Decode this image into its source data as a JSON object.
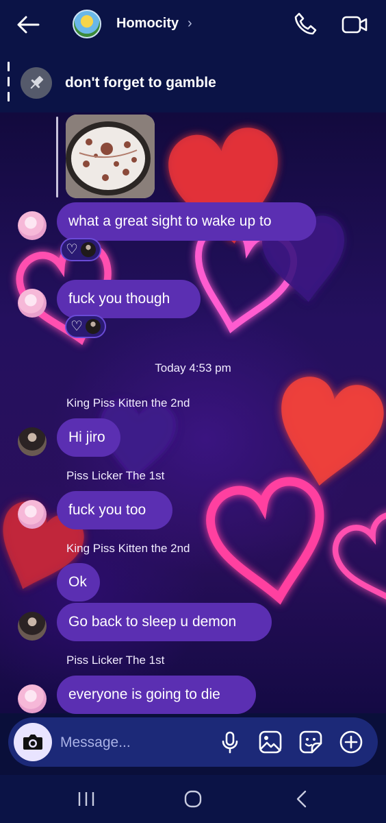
{
  "header": {
    "title": "Homocity",
    "chevron": "›",
    "icons": {
      "back": "back-arrow-icon",
      "call": "phone-icon",
      "video": "video-camera-icon"
    }
  },
  "pinned": {
    "text": "don't forget to gamble",
    "icon": "pin-icon"
  },
  "messages": [
    {
      "text": "what a great sight to wake up to",
      "reactions": [
        "♡"
      ]
    },
    {
      "text": "fuck you though",
      "reactions": [
        "♡"
      ]
    },
    {
      "sender": "King Piss Kitten the 2nd",
      "text": "Hi jiro"
    },
    {
      "sender": "Piss Licker The 1st",
      "text": "fuck you too"
    },
    {
      "sender": "King Piss Kitten the 2nd",
      "text": "Ok"
    },
    {
      "text": "Go back to sleep u demon"
    },
    {
      "sender": "Piss Licker The 1st",
      "text": "everyone is going to die"
    }
  ],
  "timestamp": "Today 4:53 pm",
  "composer": {
    "placeholder": "Message...",
    "icons": [
      "camera-icon",
      "microphone-icon",
      "image-icon",
      "sticker-icon",
      "plus-icon"
    ]
  },
  "navbar": {
    "icons": [
      "recent-apps-icon",
      "home-icon",
      "back-icon"
    ]
  },
  "colors": {
    "bubble": "#5b2fb2",
    "header": "#0b1346",
    "composer": "#1c2978"
  }
}
